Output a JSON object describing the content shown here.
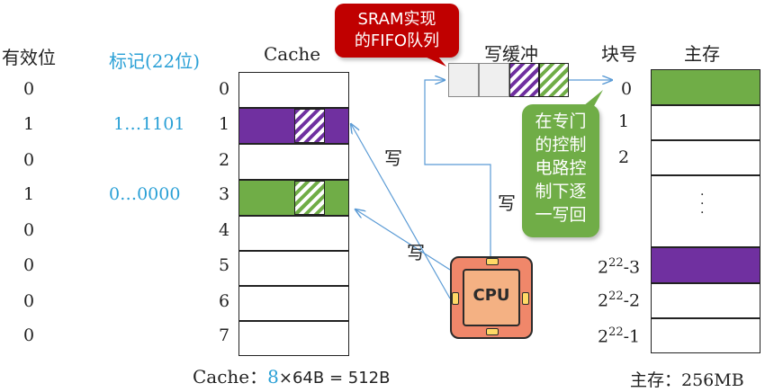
{
  "headers": {
    "valid": "有效位",
    "tag": "标记(22位)",
    "cache": "Cache",
    "write_buffer": "写缓冲",
    "block_no": "块号",
    "main_memory": "主存"
  },
  "valid_bits": [
    "0",
    "1",
    "0",
    "1",
    "0",
    "0",
    "0",
    "0"
  ],
  "tags": [
    "",
    "1…1101",
    "",
    "0…0000",
    "",
    "",
    "",
    ""
  ],
  "cache_rows": [
    "0",
    "1",
    "2",
    "3",
    "4",
    "5",
    "6",
    "7"
  ],
  "block_numbers": {
    "b0": "0",
    "b1": "1",
    "b2": "2",
    "dots": "·\n·\n·",
    "n3": "2",
    "n3_sup": "22",
    "n3_suf": "-3",
    "n2": "2",
    "n2_sup": "22",
    "n2_suf": "-2",
    "n1": "2",
    "n1_sup": "22",
    "n1_suf": "-1"
  },
  "write_labels": [
    "写",
    "写",
    "写"
  ],
  "callout_sram": "SRAM实现\n的FIFO队列",
  "callout_ctrl": "在专门\n的控制\n电路控\n制下逐\n一写回",
  "cpu_label": "CPU",
  "cache_caption": {
    "prefix": "Cache：",
    "count": "8",
    "rest": "×64B = 512B"
  },
  "memory_caption": "主存：256MB",
  "colors": {
    "purple": "#7030a0",
    "green": "#70ad47",
    "cyan": "#2aa0d6",
    "red": "#c00000",
    "cpu": "#f0876a"
  }
}
